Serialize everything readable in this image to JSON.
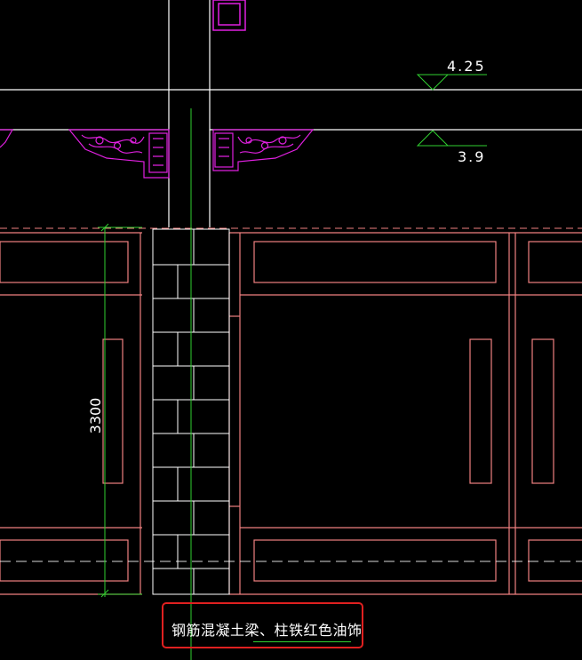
{
  "elevations": {
    "upper": "4.25",
    "lower": "3.9"
  },
  "dimension": {
    "height": "3300"
  },
  "annotation": {
    "text": "钢筋混凝土梁、柱铁红色油饰"
  },
  "colors": {
    "background": "#000000",
    "structure": "#ffffff",
    "wall": "#f08080",
    "ornament": "#e020e0",
    "dimension": "#30d030",
    "callout": "#e02020"
  }
}
